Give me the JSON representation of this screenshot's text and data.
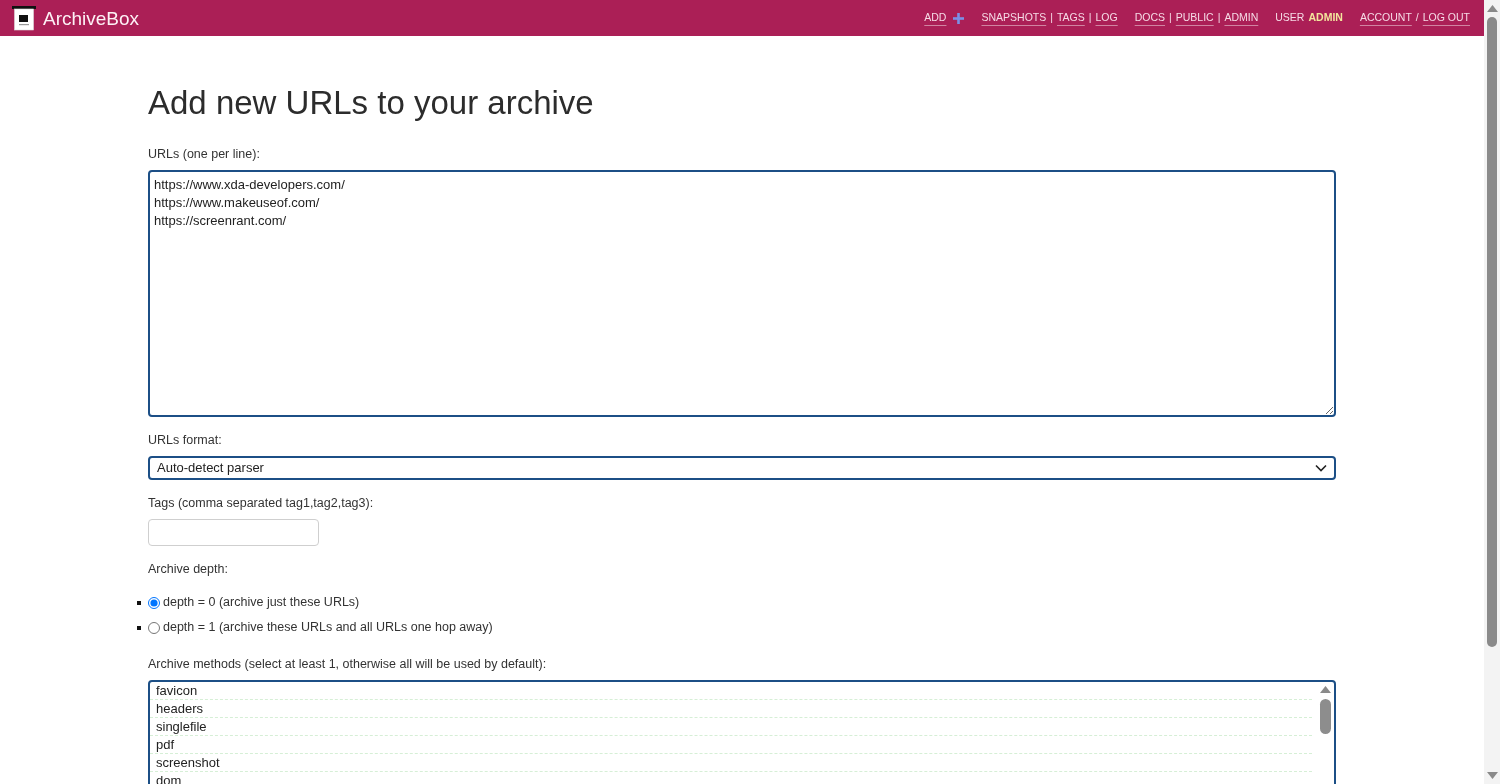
{
  "header": {
    "brand": "ArchiveBox",
    "nav_groups": [
      {
        "items": [
          {
            "kind": "add-link",
            "text": "ADD"
          }
        ]
      },
      {
        "items": [
          {
            "kind": "link",
            "text": "SNAPSHOTS"
          },
          {
            "kind": "separator",
            "text": "|"
          },
          {
            "kind": "link",
            "text": "TAGS"
          },
          {
            "kind": "separator",
            "text": "|"
          },
          {
            "kind": "link",
            "text": "LOG"
          }
        ]
      },
      {
        "items": [
          {
            "kind": "link",
            "text": "DOCS"
          },
          {
            "kind": "separator",
            "text": "|"
          },
          {
            "kind": "link",
            "text": "PUBLIC"
          },
          {
            "kind": "separator",
            "text": "|"
          },
          {
            "kind": "link",
            "text": "ADMIN"
          }
        ]
      },
      {
        "items": [
          {
            "kind": "text",
            "text": "USER"
          },
          {
            "kind": "strong",
            "text": "ADMIN"
          }
        ]
      },
      {
        "items": [
          {
            "kind": "link",
            "text": "ACCOUNT"
          },
          {
            "kind": "separator",
            "text": "/"
          },
          {
            "kind": "link",
            "text": "LOG OUT"
          }
        ]
      }
    ]
  },
  "page": {
    "title": "Add new URLs to your archive",
    "urls_field": {
      "label": "URLs (one per line):",
      "value": "https://www.xda-developers.com/\nhttps://www.makeuseof.com/\nhttps://screenrant.com/"
    },
    "format_field": {
      "label": "URLs format:",
      "value": "Auto-detect parser"
    },
    "tags_field": {
      "label": "Tags (comma separated tag1,tag2,tag3):"
    },
    "depth": {
      "label": "Archive depth:",
      "options": [
        {
          "label": "depth = 0 (archive just these URLs)",
          "selected": true
        },
        {
          "label": "depth = 1 (archive these URLs and all URLs one hop away)",
          "selected": false
        }
      ]
    },
    "methods": {
      "label": "Archive methods (select at least 1, otherwise all will be used by default):",
      "options": [
        {
          "label": "favicon",
          "selected": false
        },
        {
          "label": "headers",
          "selected": false
        },
        {
          "label": "singlefile",
          "selected": false
        },
        {
          "label": "pdf",
          "selected": false
        },
        {
          "label": "screenshot",
          "selected": false
        },
        {
          "label": "dom",
          "selected": false
        }
      ]
    }
  }
}
